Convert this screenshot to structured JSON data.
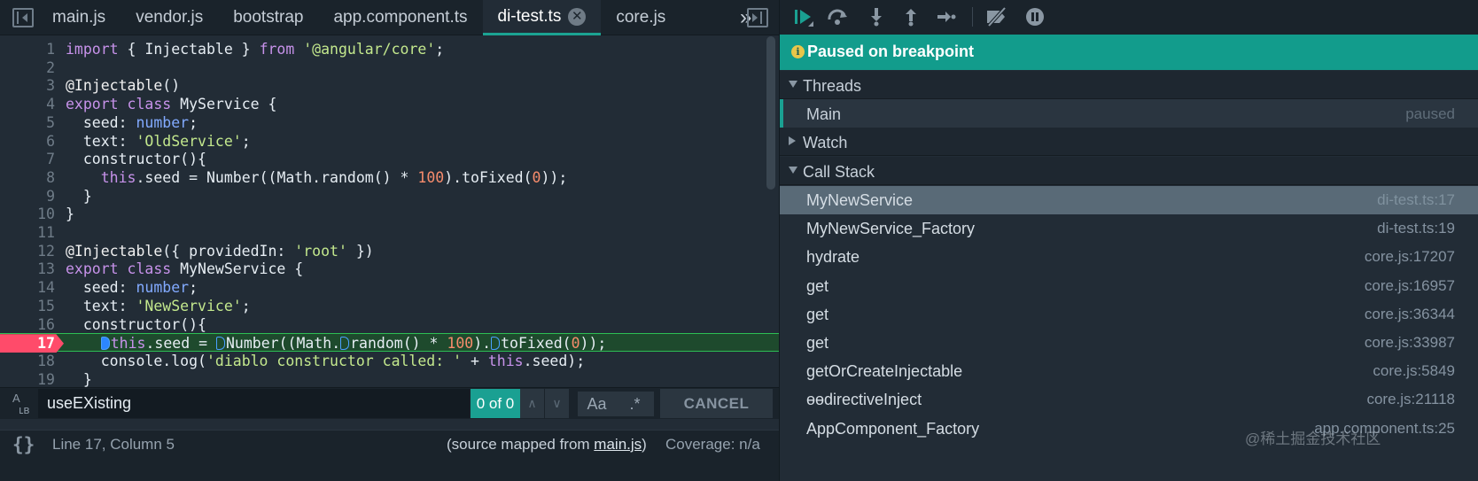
{
  "editor": {
    "tabs": [
      {
        "label": "main.js"
      },
      {
        "label": "vendor.js"
      },
      {
        "label": "bootstrap"
      },
      {
        "label": "app.component.ts"
      },
      {
        "label": "di-test.ts",
        "active": true,
        "close": "✕"
      },
      {
        "label": "core.js"
      }
    ],
    "overflow": "»",
    "lines": [
      {
        "n": "1",
        "html": "<span class='kw'>import</span> <span class='plain'>{ Injectable }</span> <span class='kw'>from</span> <span class='str'>'@angular/core'</span><span class='plain'>;</span>"
      },
      {
        "n": "2",
        "html": ""
      },
      {
        "n": "3",
        "html": "<span class='dec'>@Injectable</span><span class='plain'>()</span>"
      },
      {
        "n": "4",
        "html": "<span class='kw'>export class</span> <span class='plain'>MyService {</span>"
      },
      {
        "n": "5",
        "html": "<span class='plain'>  seed: </span><span class='kt'>number</span><span class='plain'>;</span>"
      },
      {
        "n": "6",
        "html": "<span class='plain'>  text: </span><span class='str'>'OldService'</span><span class='plain'>;</span>"
      },
      {
        "n": "7",
        "html": "<span class='plain'>  constructor(){</span>"
      },
      {
        "n": "8",
        "html": "<span class='plain'>    </span><span class='thisk'>this</span><span class='plain'>.seed = Number((Math.random() * </span><span class='num'>100</span><span class='plain'>).toFixed(</span><span class='num'>0</span><span class='plain'>));</span>"
      },
      {
        "n": "9",
        "html": "<span class='plain'>  }</span>"
      },
      {
        "n": "10",
        "html": "<span class='plain'>}</span>"
      },
      {
        "n": "11",
        "html": ""
      },
      {
        "n": "12",
        "html": "<span class='dec'>@Injectable</span><span class='plain'>({ providedIn: </span><span class='str'>'root'</span><span class='plain'> })</span>"
      },
      {
        "n": "13",
        "html": "<span class='kw'>export class</span> <span class='plain'>MyNewService {</span>"
      },
      {
        "n": "14",
        "html": "<span class='plain'>  seed: </span><span class='kt'>number</span><span class='plain'>;</span>"
      },
      {
        "n": "15",
        "html": "<span class='plain'>  text: </span><span class='str'>'NewService'</span><span class='plain'>;</span>"
      },
      {
        "n": "16",
        "html": "<span class='plain'>  constructor(){</span>"
      },
      {
        "n": "17",
        "html": "<span class='plain'>    </span><span class='mark cur'></span><span class='thisk'>this</span><span class='plain'>.seed = </span><span class='mark'></span><span class='plain'>Number((Math.</span><span class='mark'></span><span class='plain'>random() * </span><span class='num'>100</span><span class='plain'>).</span><span class='mark'></span><span class='plain'>toFixed(</span><span class='num'>0</span><span class='plain'>));</span>",
        "breakpoint": true
      },
      {
        "n": "18",
        "html": "<span class='plain'>    console.log(</span><span class='str'>'diablo constructor called: '</span><span class='plain'> + </span><span class='thisk'>this</span><span class='plain'>.seed);</span>"
      },
      {
        "n": "19",
        "html": "<span class='plain'>  }</span>"
      }
    ]
  },
  "search": {
    "case_icon": "A\n  ʟʙ",
    "value": "useEXisting",
    "match_count": "0 of 0",
    "prev": "∧",
    "next": "∨",
    "case_option": "Aa",
    "regex_option": ".*",
    "cancel": "CANCEL"
  },
  "status": {
    "braces": "{}",
    "cursor": "Line 17, Column 5",
    "mapped_prefix": "(source mapped from ",
    "mapped_file": "main.js",
    "mapped_suffix": ")",
    "coverage": "Coverage: n/a"
  },
  "debugger": {
    "paused_message": "Paused on breakpoint",
    "info_icon": "i",
    "sections": {
      "threads": "Threads",
      "watch": "Watch",
      "call_stack": "Call Stack"
    },
    "thread": {
      "name": "Main",
      "state": "paused"
    },
    "frames": [
      {
        "name": "MyNewService",
        "loc": "di-test.ts:17",
        "selected": true
      },
      {
        "name": "MyNewService_Factory",
        "loc": "di-test.ts:19"
      },
      {
        "name": "hydrate",
        "loc": "core.js:17207"
      },
      {
        "name": "get",
        "loc": "core.js:16957"
      },
      {
        "name": "get",
        "loc": "core.js:36344"
      },
      {
        "name": "get",
        "loc": "core.js:33987"
      },
      {
        "name": "getOrCreateInjectable",
        "loc": "core.js:5849"
      },
      {
        "name": "ɵɵdirectiveInject",
        "loc": "core.js:21118"
      },
      {
        "name": "AppComponent_Factory",
        "loc": "app.component.ts:25"
      }
    ]
  },
  "watermark": "@稀土掘金技术社区",
  "colors": {
    "accent": "#1aa092",
    "breakpoint": "#ff4b6a",
    "selected_frame": "#596a77",
    "current_line": "#1e4a2d"
  }
}
